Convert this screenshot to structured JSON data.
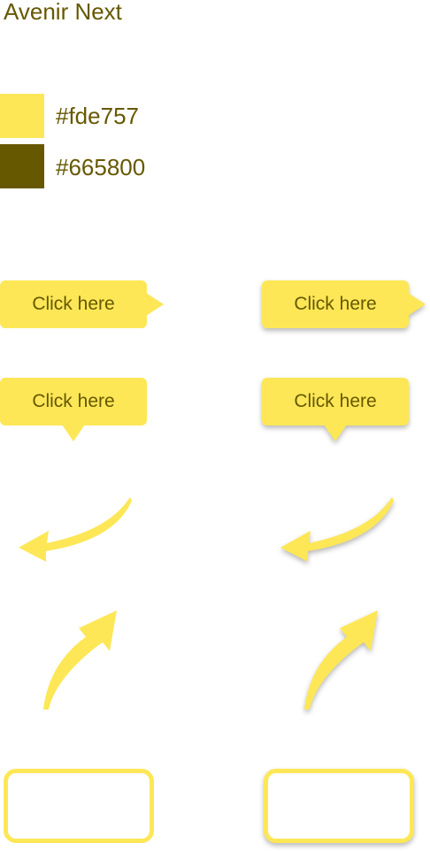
{
  "font_name": "Avenir Next",
  "colors": {
    "primary": "#fde757",
    "dark": "#665800"
  },
  "swatches": [
    {
      "label": "#fde757",
      "color": "#fde757"
    },
    {
      "label": "#665800",
      "color": "#665800"
    }
  ],
  "tooltips": {
    "label": "Click here"
  },
  "icons": {
    "curved_arrow_left": "curved-arrow-down-left-icon",
    "curved_arrow_up": "curved-arrow-up-right-icon"
  }
}
